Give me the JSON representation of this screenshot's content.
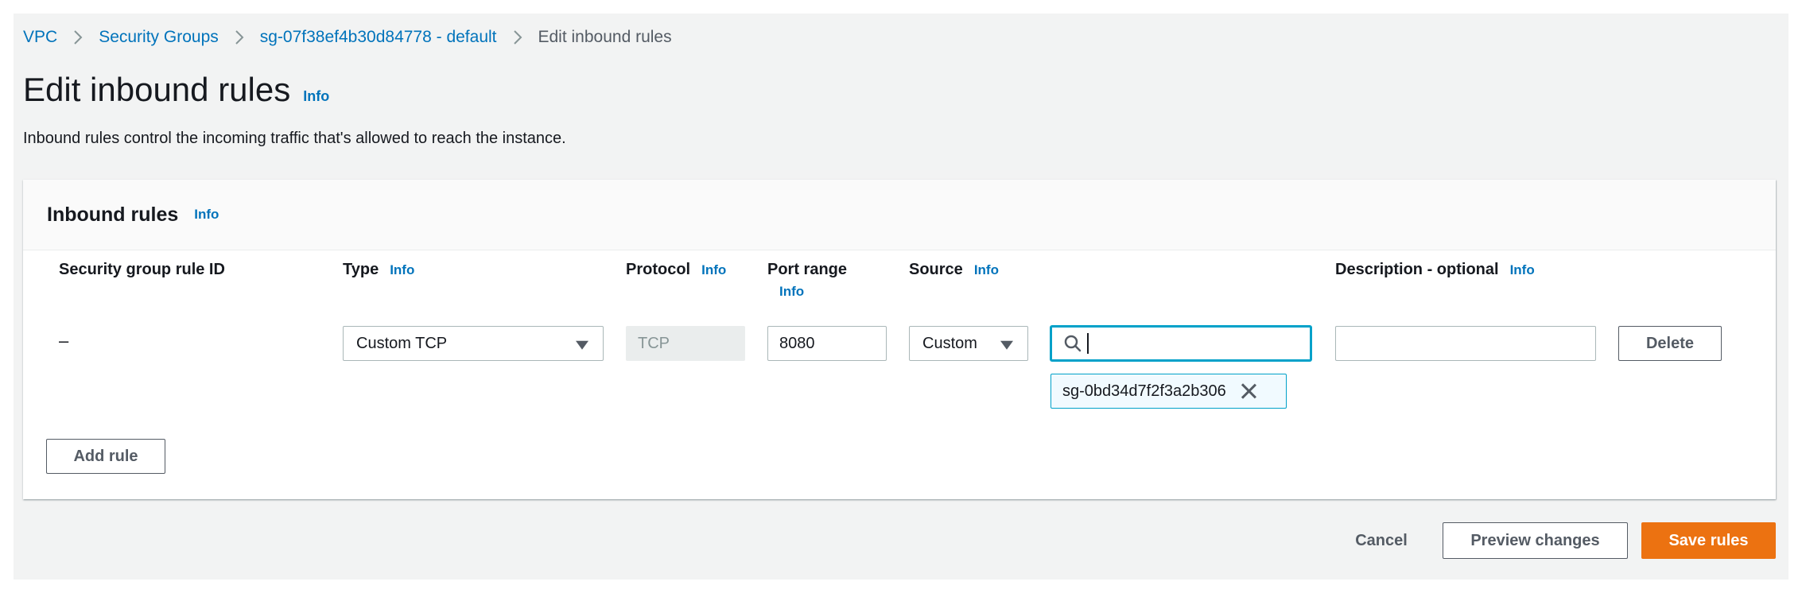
{
  "breadcrumb": {
    "items": [
      "VPC",
      "Security Groups",
      "sg-07f38ef4b30d84778 - default"
    ],
    "current": "Edit inbound rules"
  },
  "page": {
    "title": "Edit inbound rules",
    "info": "Info",
    "description": "Inbound rules control the incoming traffic that's allowed to reach the instance."
  },
  "panel": {
    "title": "Inbound rules",
    "info": "Info",
    "columns": {
      "rule_id": "Security group rule ID",
      "type": "Type",
      "protocol": "Protocol",
      "port_range": "Port range",
      "source": "Source",
      "description": "Description - optional",
      "info": "Info"
    },
    "rule": {
      "rule_id": "–",
      "type": "Custom TCP",
      "protocol": "TCP",
      "port_range": "8080",
      "source": "Custom",
      "search_value": "",
      "token": "sg-0bd34d7f2f3a2b306",
      "description": "",
      "delete_label": "Delete"
    },
    "add_rule_label": "Add rule"
  },
  "footer": {
    "cancel_label": "Cancel",
    "preview_label": "Preview changes",
    "save_label": "Save rules"
  },
  "colors": {
    "link": "#0073bb",
    "primary": "#ec7211",
    "focus": "#00a1c9",
    "background": "#f2f3f3"
  },
  "icons": [
    "chevron-right-icon",
    "caret-down-icon",
    "search-icon",
    "close-icon"
  ]
}
